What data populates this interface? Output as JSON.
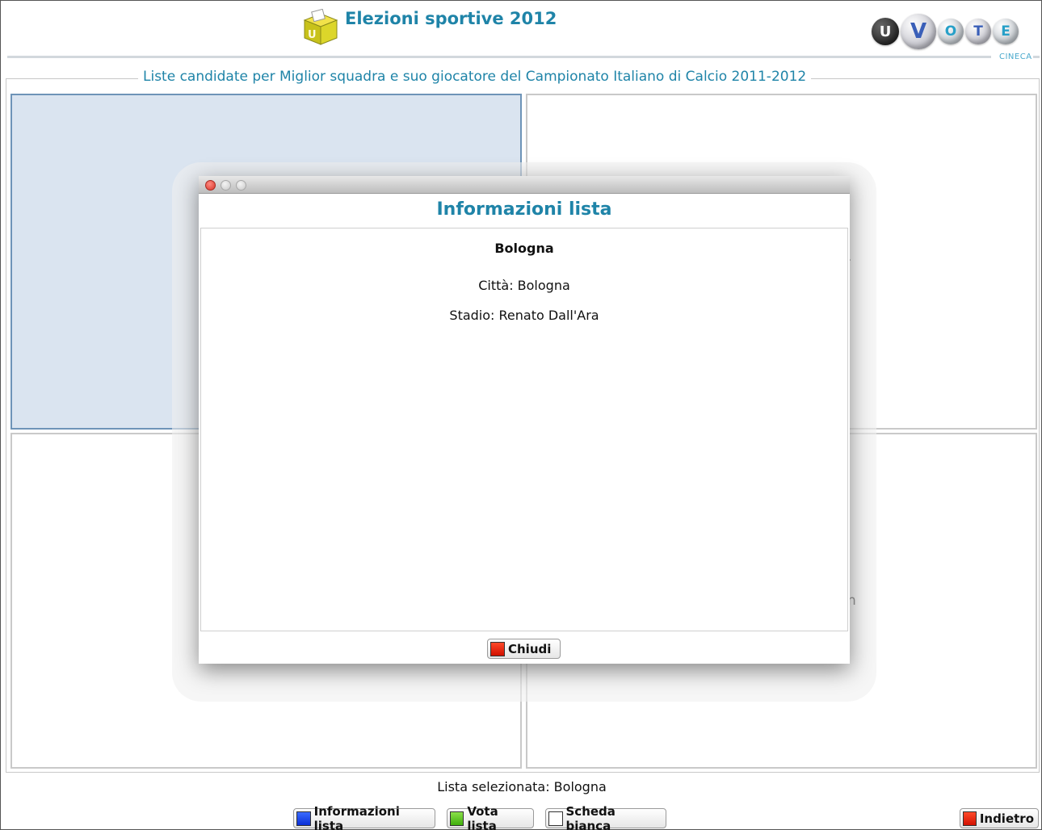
{
  "header": {
    "title": "Elezioni sportive 2012",
    "brand_letters": [
      "U",
      "V",
      "O",
      "T",
      "E"
    ],
    "brand_company": "CINECA"
  },
  "main": {
    "section_title": "Liste candidate per Miglior squadra e suo giocatore del Campionato Italiano di Calcio 2011-2012",
    "partial_text_right_top": ".",
    "partial_text_right_bottom": "n"
  },
  "footer": {
    "status_label": "Lista selezionata: Bologna",
    "buttons": {
      "info": "Informazioni lista",
      "vote": "Vota lista",
      "blank": "Scheda bianca",
      "back": "Indietro"
    }
  },
  "modal": {
    "title": "Informazioni lista",
    "list_name": "Bologna",
    "city": "Città: Bologna",
    "stadium": "Stadio: Renato Dall'Ara",
    "close_label": "Chiudi"
  },
  "colors": {
    "accent": "#1f84a8",
    "selected_card": "#dae4f0",
    "info_swatch": "#1a3fe8",
    "vote_swatch": "#5cc21c",
    "close_swatch": "#e8200a"
  },
  "icons": [
    "ballot-box-icon",
    "close-window-icon",
    "minimize-window-icon",
    "zoom-window-icon"
  ]
}
